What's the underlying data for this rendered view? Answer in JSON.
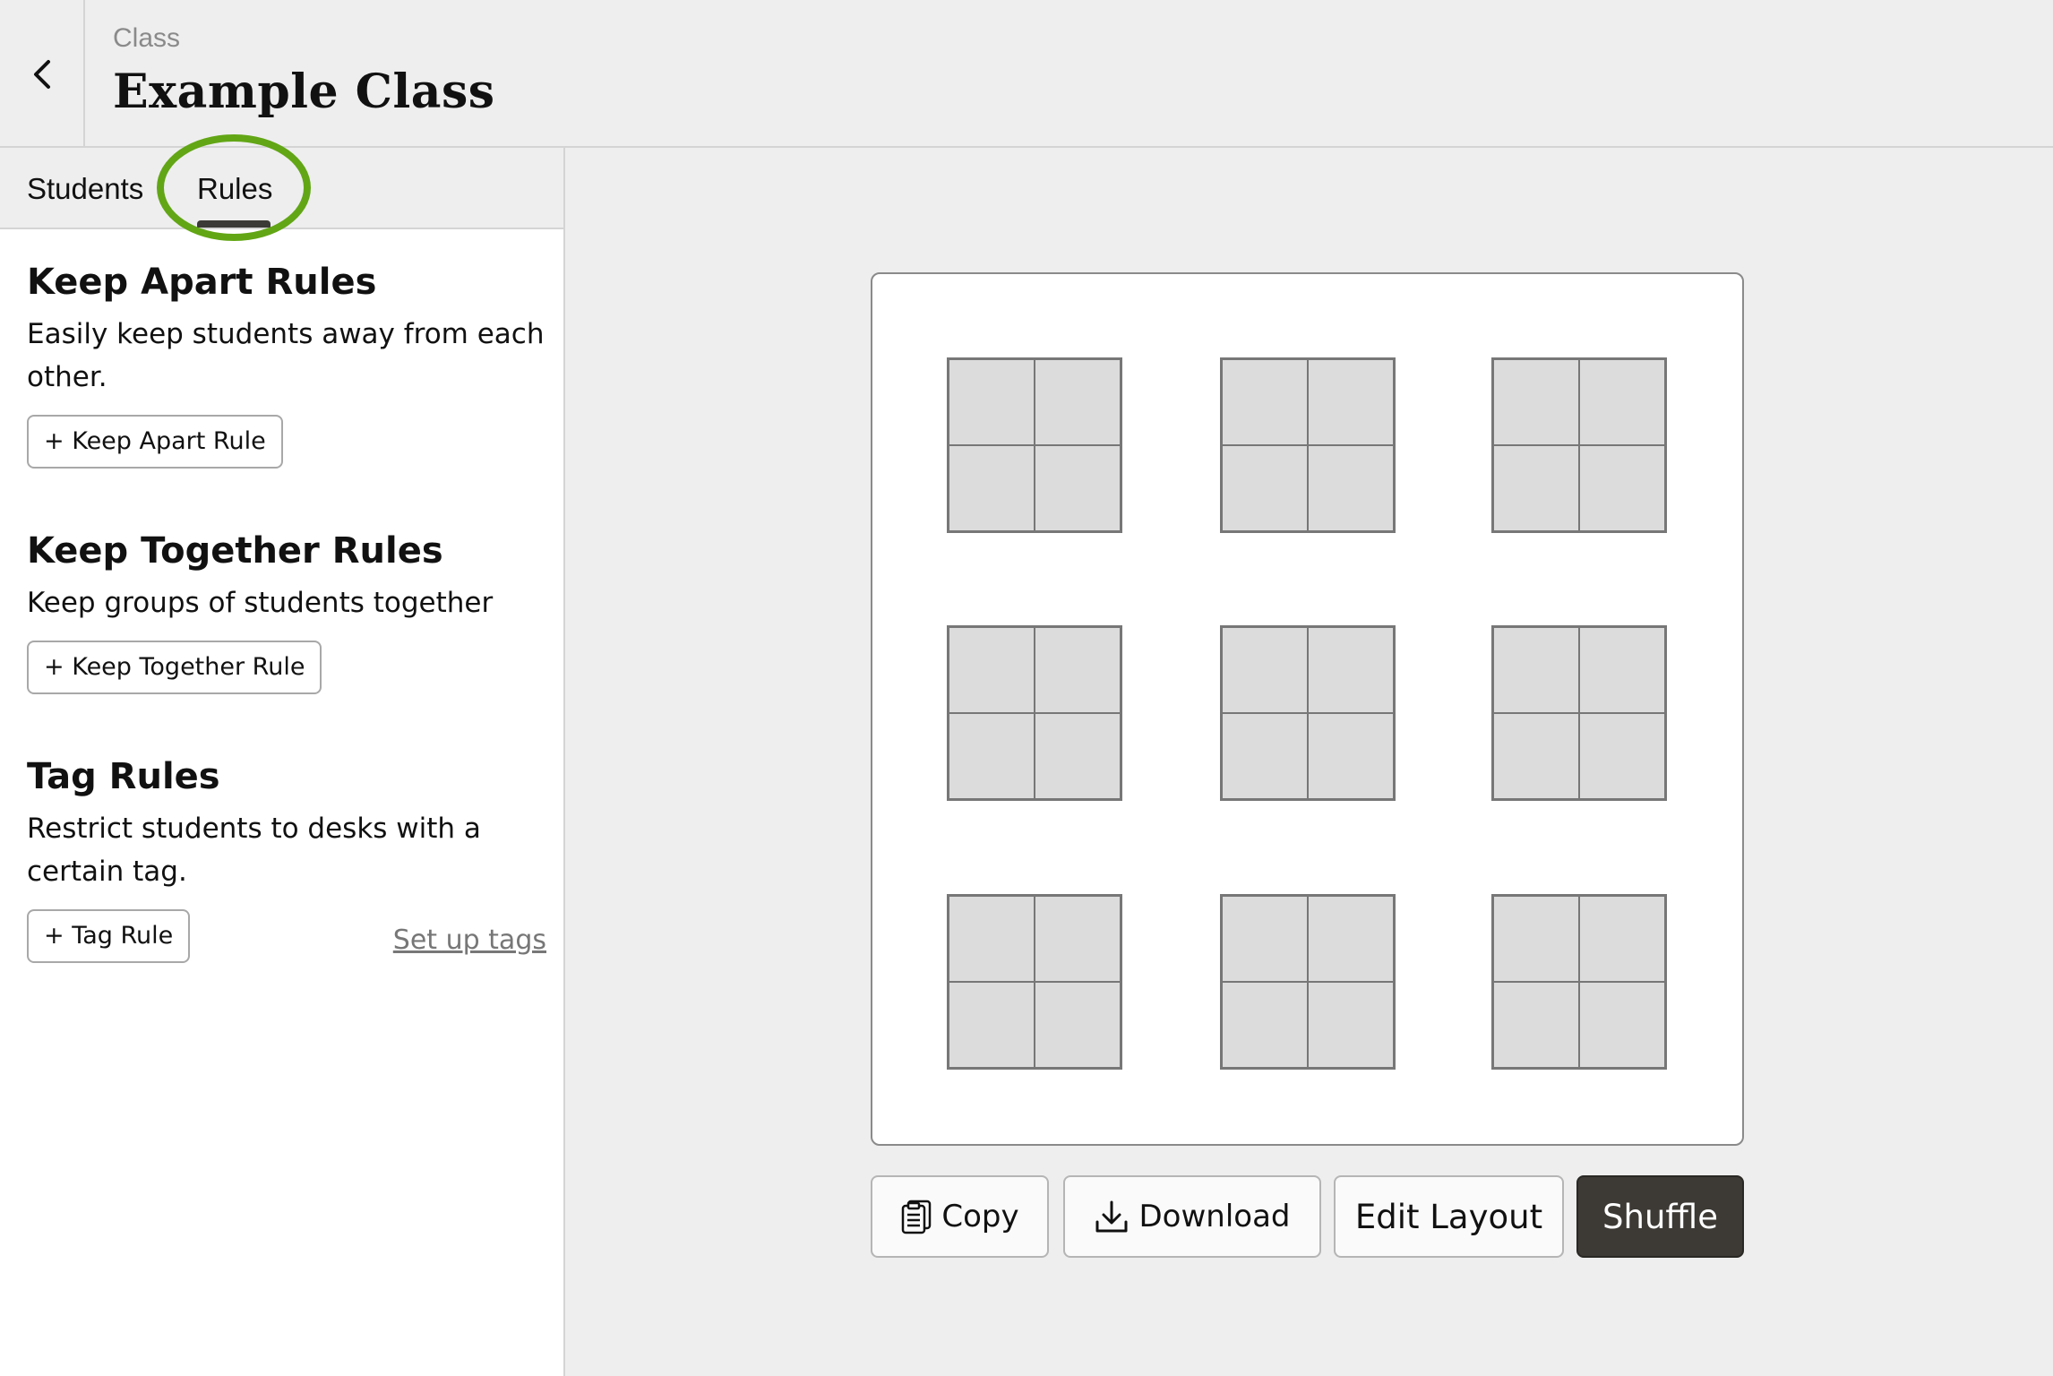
{
  "header": {
    "back_icon": "chevron-left-icon",
    "class_label": "Class",
    "class_title": "Example Class"
  },
  "tabs": [
    {
      "label": "Students",
      "active": false
    },
    {
      "label": "Rules",
      "active": true
    }
  ],
  "highlight_color": "#62a615",
  "rules": {
    "keep_apart": {
      "title": "Keep Apart Rules",
      "description": "Easily keep students away from each other.",
      "button": "+ Keep Apart Rule"
    },
    "keep_together": {
      "title": "Keep Together Rules",
      "description": "Keep groups of students together",
      "button": "+ Keep Together Rule"
    },
    "tag": {
      "title": "Tag Rules",
      "description": "Restrict students to desks with a certain tag.",
      "button": "+ Tag Rule",
      "link": "Set up tags"
    }
  },
  "classroom": {
    "desk_groups": 9,
    "desks_per_group": 4
  },
  "actions": {
    "copy": {
      "label": "Copy",
      "icon": "clipboard-icon"
    },
    "download": {
      "label": "Download",
      "icon": "download-icon"
    },
    "edit_layout": {
      "label": "Edit Layout"
    },
    "shuffle": {
      "label": "Shuffle",
      "color": "#3d3a35"
    }
  }
}
